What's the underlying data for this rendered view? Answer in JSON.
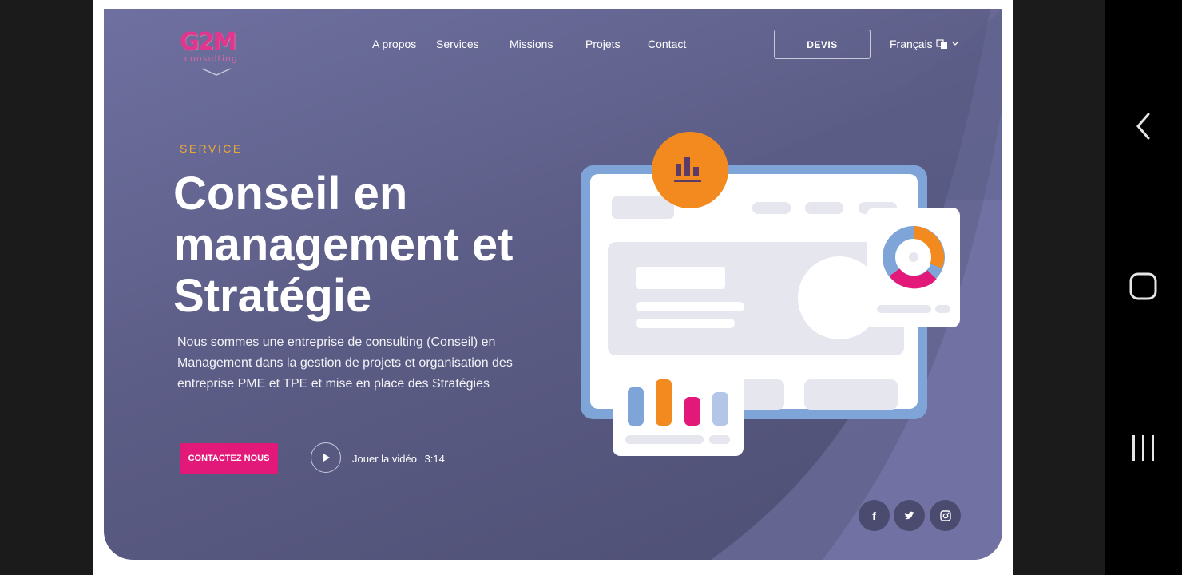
{
  "logo": {
    "text": "G2M",
    "subtext": "consulting"
  },
  "nav": {
    "items": [
      {
        "label": "A propos"
      },
      {
        "label": "Services"
      },
      {
        "label": "Missions"
      },
      {
        "label": "Projets"
      },
      {
        "label": "Contact"
      }
    ],
    "devis_label": "DEVIS",
    "language": "Français"
  },
  "hero": {
    "overline": "SERVICE",
    "headline_lines": [
      "Conseil en",
      "management et",
      "Stratégie"
    ],
    "description": "Nous sommes une entreprise de consulting (Conseil) en Management dans la gestion de projets et organisation des entreprise PME et TPE et mise en place des Stratégies",
    "cta_label": "CONTACTEZ NOUS",
    "video_label": "Jouer la vidéo",
    "video_duration": "3:14"
  },
  "social": [
    {
      "icon": "facebook-icon",
      "glyph": "f"
    },
    {
      "icon": "twitter-icon",
      "glyph": "🐦"
    },
    {
      "icon": "instagram-icon",
      "glyph": "◎"
    }
  ],
  "colors": {
    "accent_pink": "#e3197a",
    "accent_orange": "#f28a20",
    "accent_gold": "#e9a93a",
    "hero_bg": "#5c5d86",
    "illustration_blue": "#7ea4d8"
  }
}
